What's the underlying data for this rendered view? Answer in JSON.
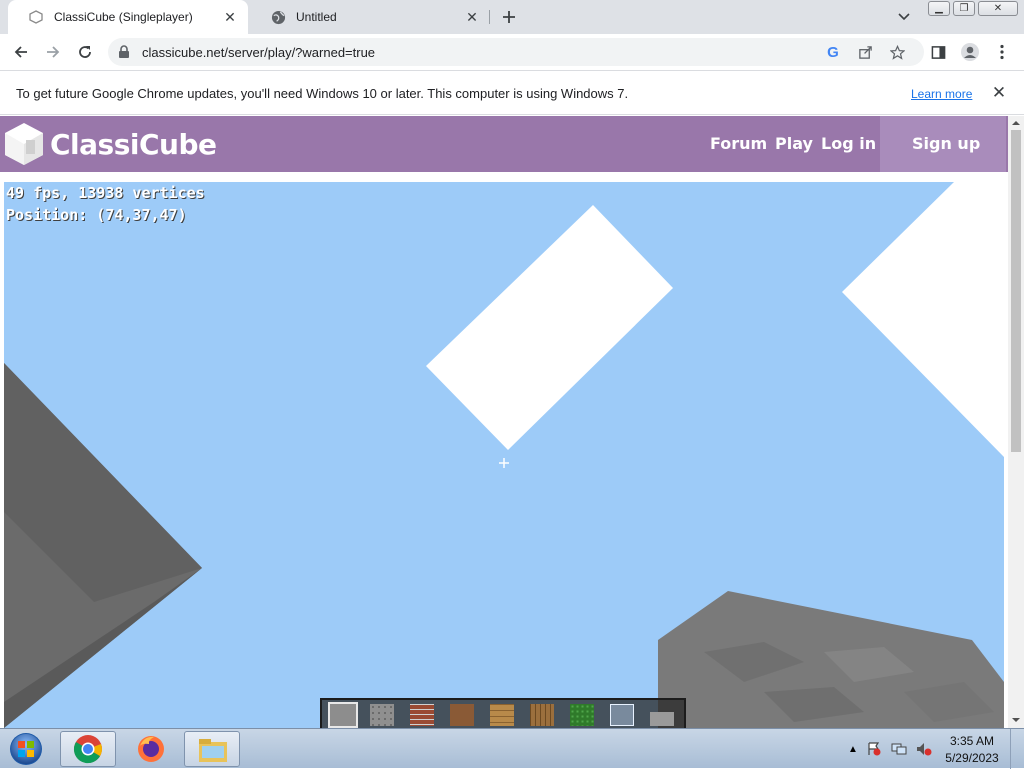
{
  "tabs": [
    {
      "title": "ClassiCube (Singleplayer)",
      "favicon": "classicube-favicon-icon",
      "active": true
    },
    {
      "title": "Untitled",
      "favicon": "globe-icon",
      "active": false
    }
  ],
  "omnibox": {
    "url": "classicube.net/server/play/?warned=true"
  },
  "infobar": {
    "message": "To get future Google Chrome updates, you'll need Windows 10 or later. This computer is using Windows 7.",
    "link": "Learn more"
  },
  "site": {
    "logo_text": "ClassiCube",
    "nav": {
      "forum": "Forum",
      "play": "Play",
      "login": "Log in",
      "signup": "Sign up"
    },
    "header_color": "#9977aa"
  },
  "game": {
    "hud_line1": "49 fps, 13938 vertices",
    "hud_line2": "Position: (74,37,47)",
    "sky_color": "#9dcbf8",
    "hotbar_selected_index": 0,
    "hotbar_blocks": [
      "stone",
      "cobblestone",
      "brick",
      "dirt",
      "planks",
      "log",
      "leaves",
      "glass",
      "slab"
    ]
  },
  "taskbar": {
    "time": "3:35 AM",
    "date": "5/29/2023",
    "apps": [
      "chrome-icon",
      "firefox-icon",
      "file-explorer-icon"
    ]
  }
}
